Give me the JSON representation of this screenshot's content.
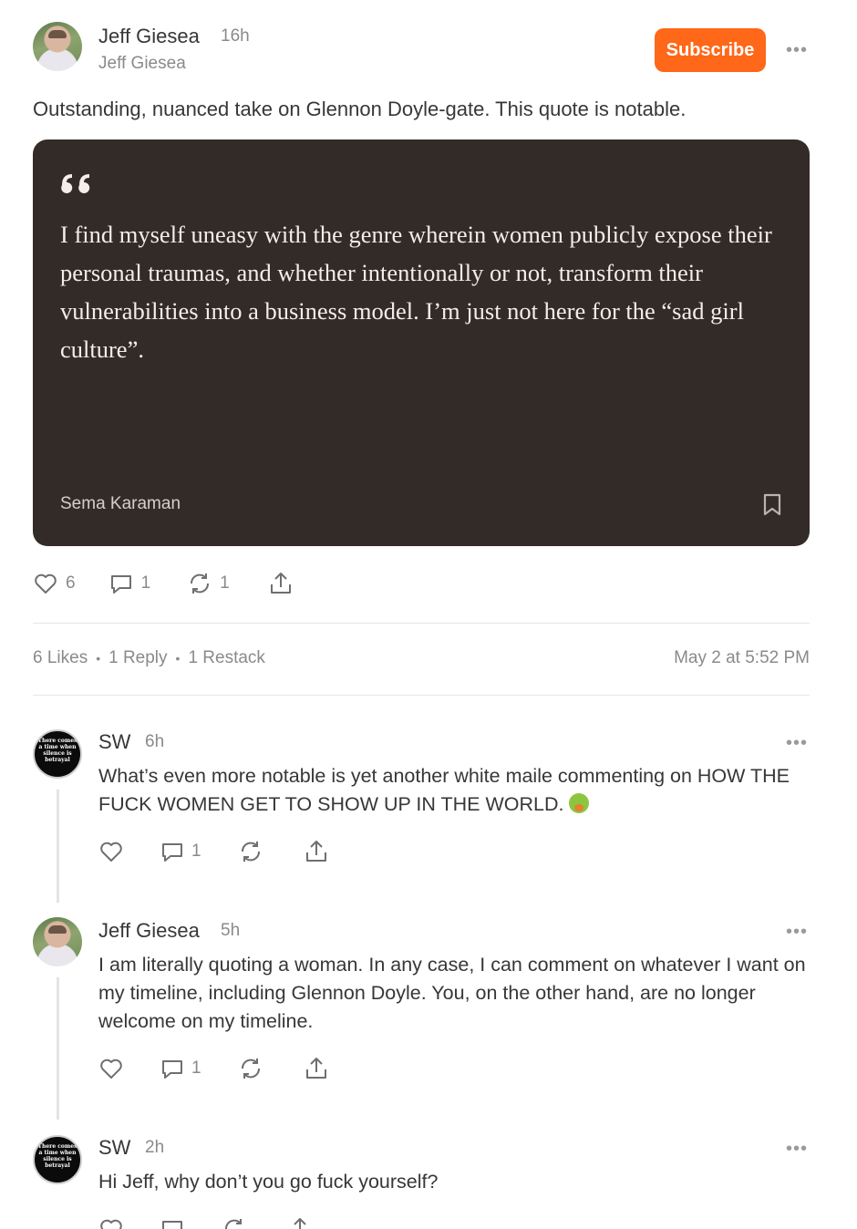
{
  "post": {
    "author": "Jeff Giesea",
    "time": "16h",
    "handle": "Jeff Giesea",
    "subscribe_label": "Subscribe",
    "more": "•••",
    "text": "Outstanding, nuanced take on Glennon Doyle-gate. This quote is notable.",
    "quote": {
      "mark": "“",
      "text": "I find myself uneasy with the genre wherein women publicly expose their personal traumas, and whether intentionally or not, transform their vulnerabilities into a business model. I’m just not here for the “sad girl culture”.",
      "author": "Sema Karaman"
    },
    "actions": {
      "likes": "6",
      "replies": "1",
      "restacks": "1"
    },
    "stats": {
      "likes": "6 Likes",
      "replies": "1 Reply",
      "restacks": "1 Restack",
      "separator": "•"
    },
    "date": "May 2 at 5:52 PM"
  },
  "comments": [
    {
      "author": "SW",
      "time": "6h",
      "avatar_text": [
        "There comes",
        "a time when",
        "silence is",
        "betrayal"
      ],
      "text": "What’s even more notable is yet another white maile commenting on HOW THE FUCK WOMEN GET TO SHOW UP IN THE WORLD.",
      "emoji": "nauseated-face-emoji",
      "replies": "1"
    },
    {
      "author": "Jeff Giesea",
      "time": "5h",
      "text": "I am literally quoting a woman. In any case, I can comment on whatever I want on my timeline, including Glennon Doyle. You, on the other hand, are no longer welcome on my timeline.",
      "replies": "1"
    },
    {
      "author": "SW",
      "time": "2h",
      "avatar_text": [
        "There comes",
        "a time when",
        "silence is",
        "betrayal"
      ],
      "text": "Hi Jeff, why don’t you go fuck yourself?"
    }
  ],
  "colors": {
    "accent": "#ff6719",
    "quote_bg": "#332b27",
    "muted": "#8a8a8a"
  }
}
